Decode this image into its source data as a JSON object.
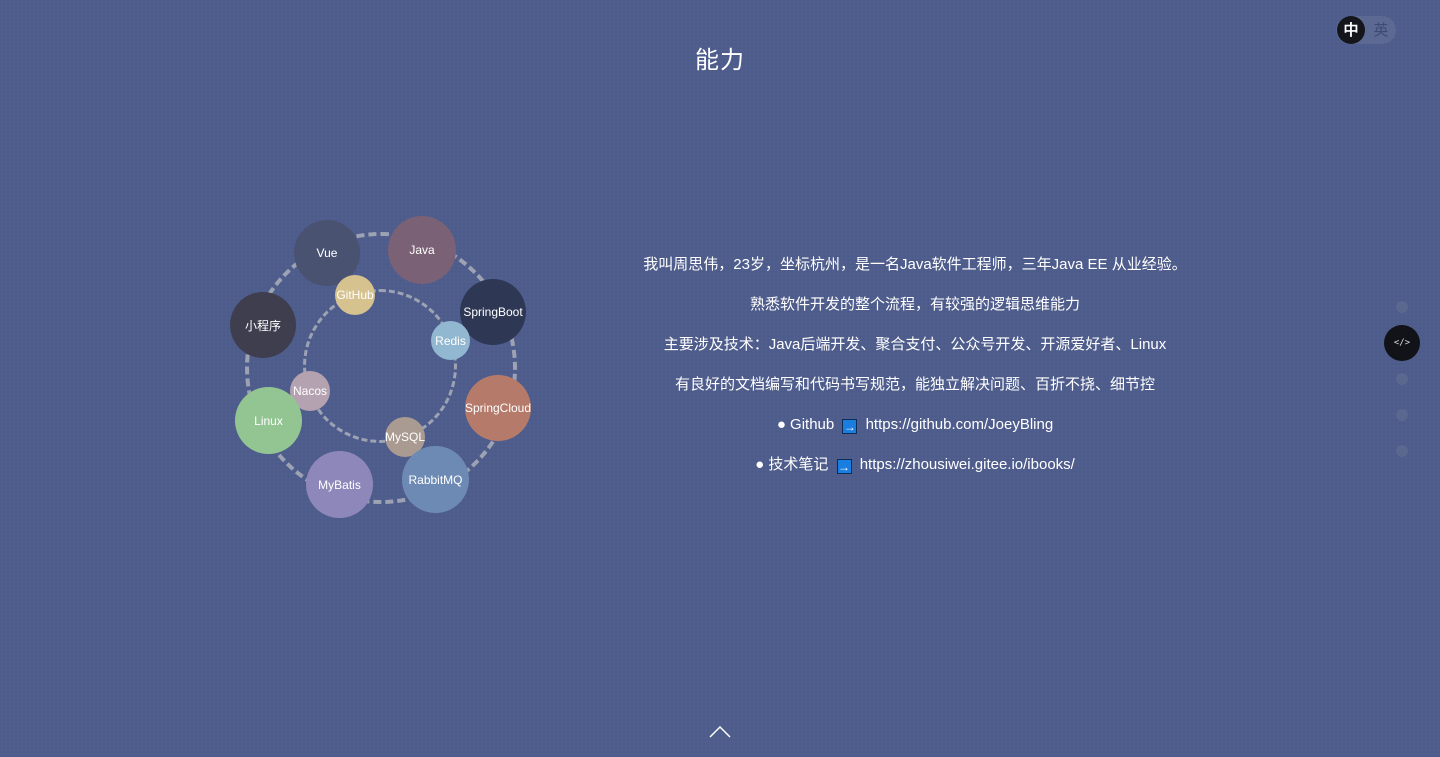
{
  "header": {
    "title": "能力"
  },
  "lang_switch": {
    "active": "中",
    "inactive": "英"
  },
  "skills": [
    {
      "label": "Vue",
      "color": "#4a5271"
    },
    {
      "label": "Java",
      "color": "#7b6175"
    },
    {
      "label": "SpringBoot",
      "color": "#2e3855"
    },
    {
      "label": "小程序",
      "color": "#3e3e4e"
    },
    {
      "label": "GitHub",
      "color": "#d6c28e"
    },
    {
      "label": "Redis",
      "color": "#91b7d1"
    },
    {
      "label": "Nacos",
      "color": "#b5a2b1"
    },
    {
      "label": "SpringCloud",
      "color": "#b57a6a"
    },
    {
      "label": "Linux",
      "color": "#93c592"
    },
    {
      "label": "MySQL",
      "color": "#a99a92"
    },
    {
      "label": "MyBatis",
      "color": "#8e87ba"
    },
    {
      "label": "RabbitMQ",
      "color": "#6c8ab3"
    }
  ],
  "intro": {
    "line1": "我叫周思伟，23岁，坐标杭州，是一名Java软件工程师，三年Java EE 从业经验。",
    "line2": "熟悉软件开发的整个流程，有较强的逻辑思维能力",
    "line3": "主要涉及技术：Java后端开发、聚合支付、公众号开发、开源爱好者、Linux",
    "line4": "有良好的文档编写和代码书写规范，能独立解决问题、百折不挠、细节控",
    "github_label": "● Github",
    "github_url": "https://github.com/JoeyBling",
    "notes_label": "● 技术笔记",
    "notes_url": "https://zhousiwei.gitee.io/ibooks/",
    "arrow": "→"
  },
  "nav": {
    "active_icon_text": "</>",
    "active_icon": "code-icon"
  },
  "scroll": {
    "icon": "chevron-up-icon"
  }
}
